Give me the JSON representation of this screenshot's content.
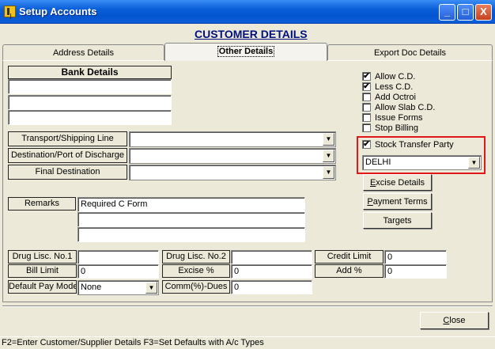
{
  "window": {
    "title": "Setup Accounts",
    "min": "_",
    "max": "□",
    "close": "X"
  },
  "heading": "CUSTOMER DETAILS",
  "tabs": [
    {
      "label": "Address Details"
    },
    {
      "label": "Other Details"
    },
    {
      "label": "Export Doc Details"
    }
  ],
  "bank": {
    "label": "Bank Details",
    "lines": [
      "",
      "",
      ""
    ]
  },
  "shipping": {
    "transport_label": "Transport/Shipping Line",
    "destination_label": "Destination/Port of Discharge",
    "final_label": "Final Destination",
    "transport_value": "",
    "destination_value": "",
    "final_value": ""
  },
  "remarks": {
    "label": "Remarks",
    "lines": [
      "Required C Form",
      "",
      ""
    ]
  },
  "options": [
    {
      "label": "Allow C.D.",
      "checked": true
    },
    {
      "label": "Less C.D.",
      "checked": true
    },
    {
      "label": "Add Octroi",
      "checked": false
    },
    {
      "label": "Allow Slab C.D.",
      "checked": false
    },
    {
      "label": "Issue Forms",
      "checked": false
    },
    {
      "label": "Stop Billing",
      "checked": false
    }
  ],
  "stock_transfer": {
    "label": "Stock Transfer Party",
    "checked": true,
    "value": "DELHI"
  },
  "buttons": {
    "excise_pre": "",
    "excise_key": "E",
    "excise_rest": "xcise Details",
    "payment_pre": "",
    "payment_key": "P",
    "payment_rest": "ayment Terms",
    "targets": "Targets",
    "close_pre": "",
    "close_key": "C",
    "close_rest": "lose"
  },
  "licence": {
    "drug1_label": "Drug Lisc. No.1",
    "drug1_value": "",
    "drug2_label": "Drug Lisc. No.2",
    "drug2_value": "",
    "credit_label": "Credit Limit",
    "credit_value": "0",
    "bill_label": "Bill Limit",
    "bill_value": "0",
    "excise_label": "Excise %",
    "excise_value": "0",
    "add_label": "Add %",
    "add_value": "0",
    "paymode_label": "Default Pay Mode",
    "paymode_value": "None",
    "comm_label": "Comm(%)-Dues",
    "comm_value": "0"
  },
  "status": "F2=Enter Customer/Supplier Details   F3=Set Defaults with A/c Types"
}
